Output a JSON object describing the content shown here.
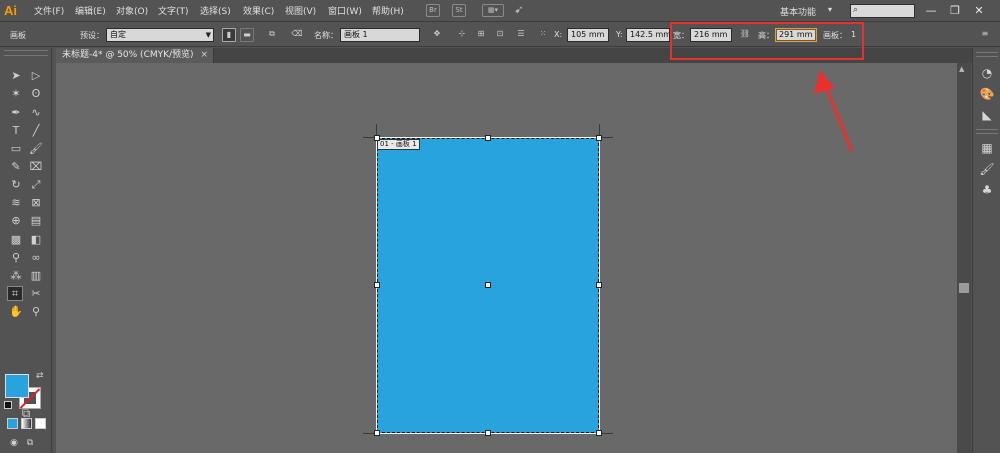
{
  "app": {
    "logo": "Ai"
  },
  "menu": [
    "文件(F)",
    "编辑(E)",
    "对象(O)",
    "文字(T)",
    "选择(S)",
    "效果(C)",
    "视图(V)",
    "窗口(W)",
    "帮助(H)"
  ],
  "menubar_icons": {
    "bridge": "Br",
    "stock": "St"
  },
  "workspace": {
    "label": "基本功能",
    "caret": "▾"
  },
  "search": {
    "icon": "search-icon",
    "placeholder": ""
  },
  "window_controls": {
    "minimize": "—",
    "restore": "❐",
    "close": "✕"
  },
  "control_bar": {
    "panel_label": "画板",
    "preset_label": "预设：",
    "preset_value": "自定",
    "name_label": "名称：",
    "name_value": "画板 1",
    "x_label": "X:",
    "x_value": "105 mm",
    "y_label": "Y:",
    "y_value": "142.5 mm",
    "w_label": "宽：",
    "w_value": "216 mm",
    "h_label": "高：",
    "h_value": "291 mm",
    "artboards_label": "画板：",
    "artboards_count": "1"
  },
  "document_tab": {
    "title": "未标题-4* @ 50% (CMYK/预览)",
    "close": "×"
  },
  "artboard": {
    "label": "01 - 画板 1",
    "fill_color": "#29a3de"
  },
  "colors": {
    "fill": "#29a3de",
    "annotation": "#e8312f",
    "accent": "#ff9a00"
  },
  "annotation": {
    "type": "red-box-with-arrow",
    "target": "width-height-fields"
  }
}
